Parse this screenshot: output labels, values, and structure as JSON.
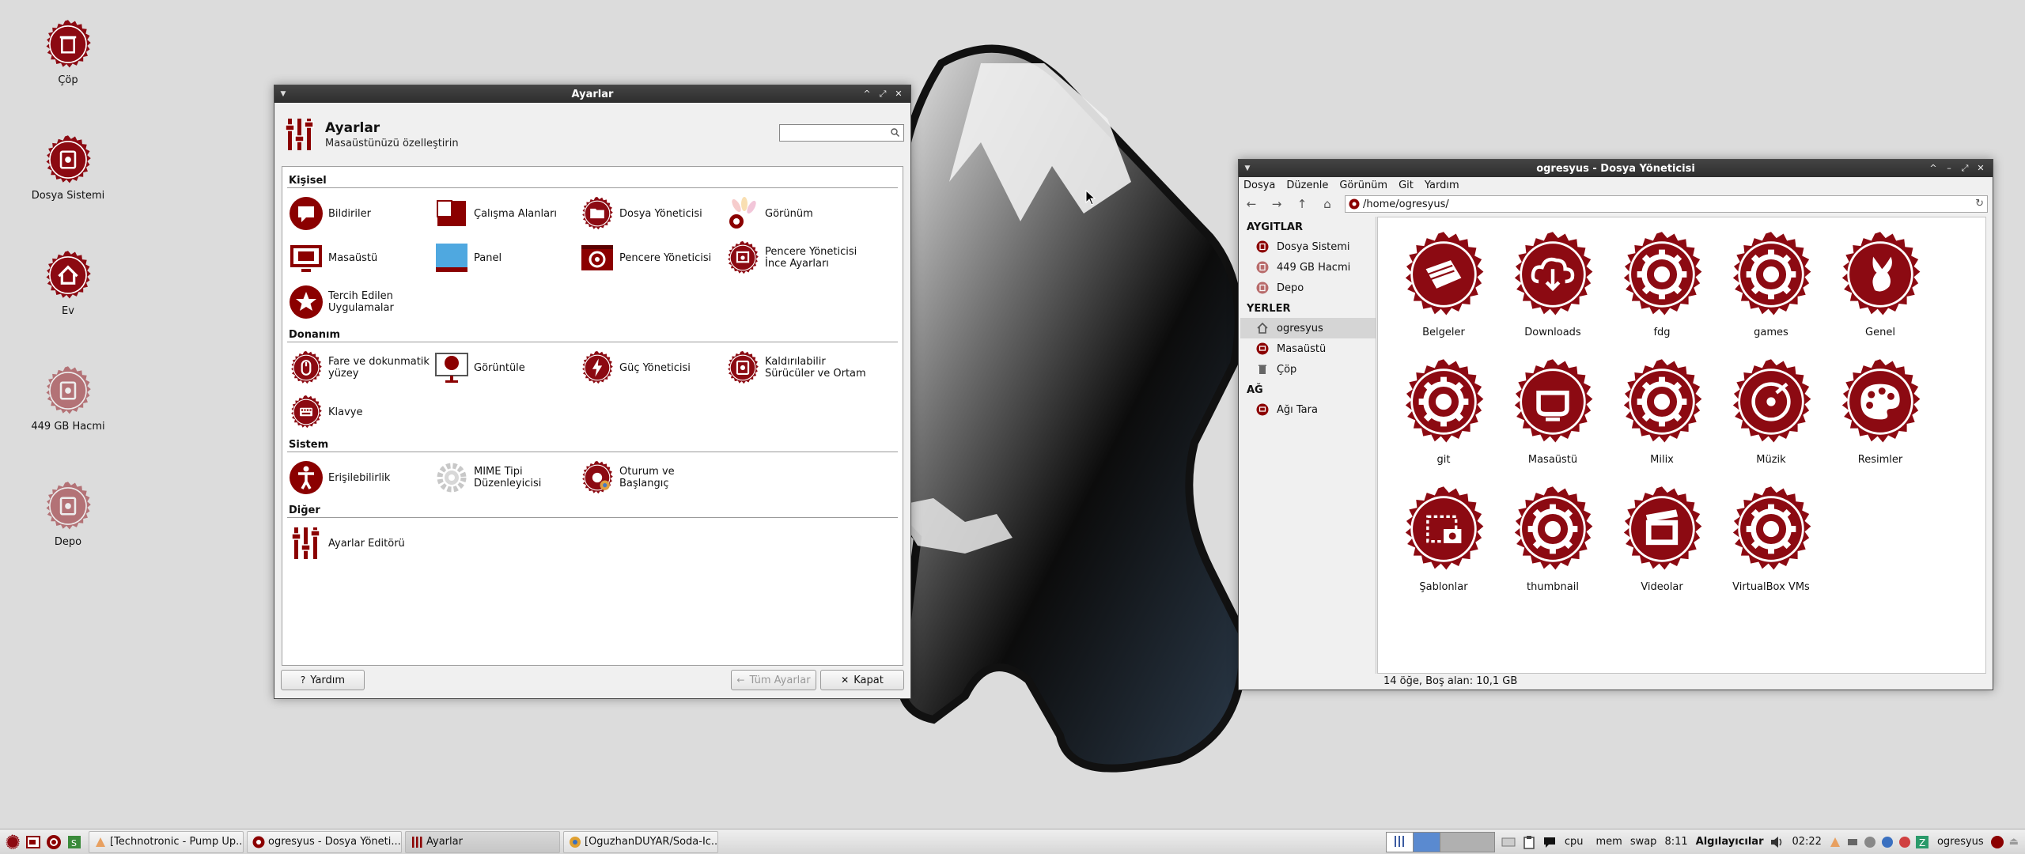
{
  "colors": {
    "brand_red": "#8b0000",
    "folder_red": "#8c0a12",
    "titlebar": "#3a3a3a"
  },
  "desktop": {
    "icons": [
      {
        "label": "Çöp",
        "icon": "trash-icon"
      },
      {
        "label": "Dosya Sistemi",
        "icon": "filesystem-icon"
      },
      {
        "label": "Ev",
        "icon": "home-icon"
      },
      {
        "label": "449 GB Hacmi",
        "icon": "drive-icon"
      },
      {
        "label": "Depo",
        "icon": "drive-icon"
      }
    ]
  },
  "settings": {
    "window_title": "Ayarlar",
    "header_title": "Ayarlar",
    "header_subtitle": "Masaüstünüzü özelleştirin",
    "search_value": "",
    "categories": [
      {
        "title": "Kişisel",
        "items": [
          {
            "label": "Bildiriler",
            "icon": "notification-icon"
          },
          {
            "label": "Çalışma Alanları",
            "icon": "workspaces-icon"
          },
          {
            "label": "Dosya Yöneticisi",
            "icon": "file-manager-icon"
          },
          {
            "label": "Görünüm",
            "icon": "appearance-icon"
          },
          {
            "label": "Masaüstü",
            "icon": "desktop-icon"
          },
          {
            "label": "Panel",
            "icon": "panel-icon"
          },
          {
            "label": "Pencere Yöneticisi",
            "icon": "window-manager-icon"
          },
          {
            "label": "Pencere Yöneticisi İnce Ayarları",
            "icon": "window-tweaks-icon"
          },
          {
            "label": "Tercih Edilen Uygulamalar",
            "icon": "preferred-apps-icon"
          }
        ]
      },
      {
        "title": "Donanım",
        "items": [
          {
            "label": "Fare ve dokunmatik yüzey",
            "icon": "mouse-icon"
          },
          {
            "label": "Görüntüle",
            "icon": "display-icon"
          },
          {
            "label": "Güç Yöneticisi",
            "icon": "power-icon"
          },
          {
            "label": "Kaldırılabilir Sürücüler ve Ortam",
            "icon": "removable-drive-icon"
          },
          {
            "label": "Klavye",
            "icon": "keyboard-icon"
          }
        ]
      },
      {
        "title": "Sistem",
        "items": [
          {
            "label": "Erişilebilirlik",
            "icon": "accessibility-icon"
          },
          {
            "label": "MIME Tipi Düzenleyicisi",
            "icon": "mime-gear-icon"
          },
          {
            "label": "Oturum ve Başlangıç",
            "icon": "session-icon"
          }
        ]
      },
      {
        "title": "Diğer",
        "items": [
          {
            "label": "Ayarlar Editörü",
            "icon": "settings-editor-icon"
          }
        ]
      }
    ],
    "buttons": {
      "help": "Yardım",
      "all_settings": "Tüm Ayarlar",
      "close": "Kapat"
    }
  },
  "file_manager": {
    "window_title": "ogresyus - Dosya Yöneticisi",
    "menu": [
      "Dosya",
      "Düzenle",
      "Görünüm",
      "Git",
      "Yardım"
    ],
    "path": "/home/ogresyus/",
    "sidebar": {
      "devices_title": "AYGITLAR",
      "devices": [
        "Dosya Sistemi",
        "449 GB Hacmi",
        "Depo"
      ],
      "places_title": "YERLER",
      "places": [
        "ogresyus",
        "Masaüstü",
        "Çöp"
      ],
      "network_title": "AĞ",
      "network": [
        "Ağı Tara"
      ]
    },
    "folders": [
      {
        "label": "Belgeler",
        "icon": "documents-folder-icon"
      },
      {
        "label": "Downloads",
        "icon": "downloads-folder-icon"
      },
      {
        "label": "fdg",
        "icon": "folder-icon"
      },
      {
        "label": "games",
        "icon": "folder-icon"
      },
      {
        "label": "Genel",
        "icon": "public-folder-icon"
      },
      {
        "label": "git",
        "icon": "folder-icon"
      },
      {
        "label": "Masaüstü",
        "icon": "desktop-folder-icon"
      },
      {
        "label": "Milix",
        "icon": "folder-icon"
      },
      {
        "label": "Müzik",
        "icon": "music-folder-icon"
      },
      {
        "label": "Resimler",
        "icon": "pictures-folder-icon"
      },
      {
        "label": "Şablonlar",
        "icon": "templates-folder-icon"
      },
      {
        "label": "thumbnail",
        "icon": "folder-icon"
      },
      {
        "label": "Videolar",
        "icon": "videos-folder-icon"
      },
      {
        "label": "VirtualBox VMs",
        "icon": "folder-icon"
      }
    ],
    "status": "14 öğe, Boş alan: 10,1 GB"
  },
  "taskbar": {
    "tasks": [
      {
        "label": "[Technotronic - Pump Up...",
        "icon": "audio-app-icon"
      },
      {
        "label": "ogresyus - Dosya Yöneti...",
        "icon": "file-manager-icon"
      },
      {
        "label": "Ayarlar",
        "icon": "settings-icon"
      },
      {
        "label": "[OguzhanDUYAR/Soda-Ic...",
        "icon": "browser-icon"
      }
    ],
    "cpu": "cpu",
    "mem": "mem",
    "swap": "swap",
    "time1": "8:11",
    "sensors": "Algılayıcılar",
    "time2": "02:22",
    "user": "ogresyus"
  }
}
